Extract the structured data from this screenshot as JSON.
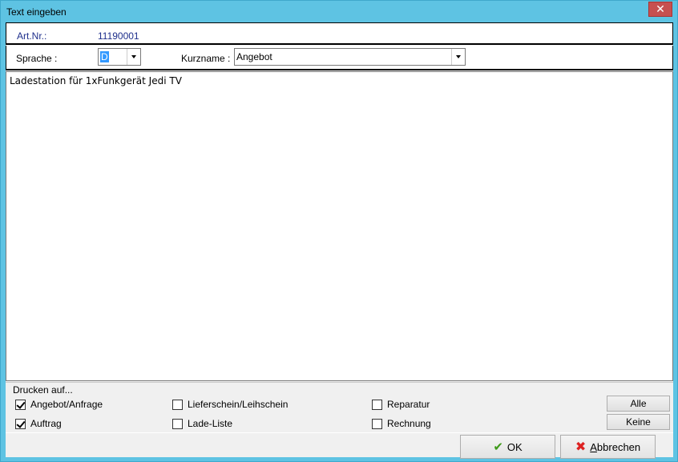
{
  "window": {
    "title": "Text eingeben",
    "close_symbol": "✕"
  },
  "article": {
    "label": "Art.Nr.:",
    "value": "11190001"
  },
  "language": {
    "label": "Sprache :",
    "value": "D"
  },
  "shortname": {
    "label": "Kurzname :",
    "value": "Angebot"
  },
  "text": {
    "content": "Ladestation für 1xFunkgerät Jedi TV"
  },
  "print": {
    "title": "Drucken auf...",
    "options": [
      {
        "label": "Angebot/Anfrage",
        "checked": true
      },
      {
        "label": "Auftrag",
        "checked": true
      },
      {
        "label": "Lieferschein/Leihschein",
        "checked": false
      },
      {
        "label": "Lade-Liste",
        "checked": false
      },
      {
        "label": "Reparatur",
        "checked": false
      },
      {
        "label": "Rechnung",
        "checked": false
      }
    ],
    "all_label": "Alle",
    "none_label": "Keine"
  },
  "buttons": {
    "ok_label": "OK",
    "ok_icon": "checkmark-icon",
    "cancel_label": "Abbrechen",
    "cancel_icon": "x-icon"
  },
  "colors": {
    "titlebar": "#5ec3e3",
    "label_blue": "#1e2f8c",
    "close_red": "#c75050",
    "selection": "#3399ff"
  }
}
